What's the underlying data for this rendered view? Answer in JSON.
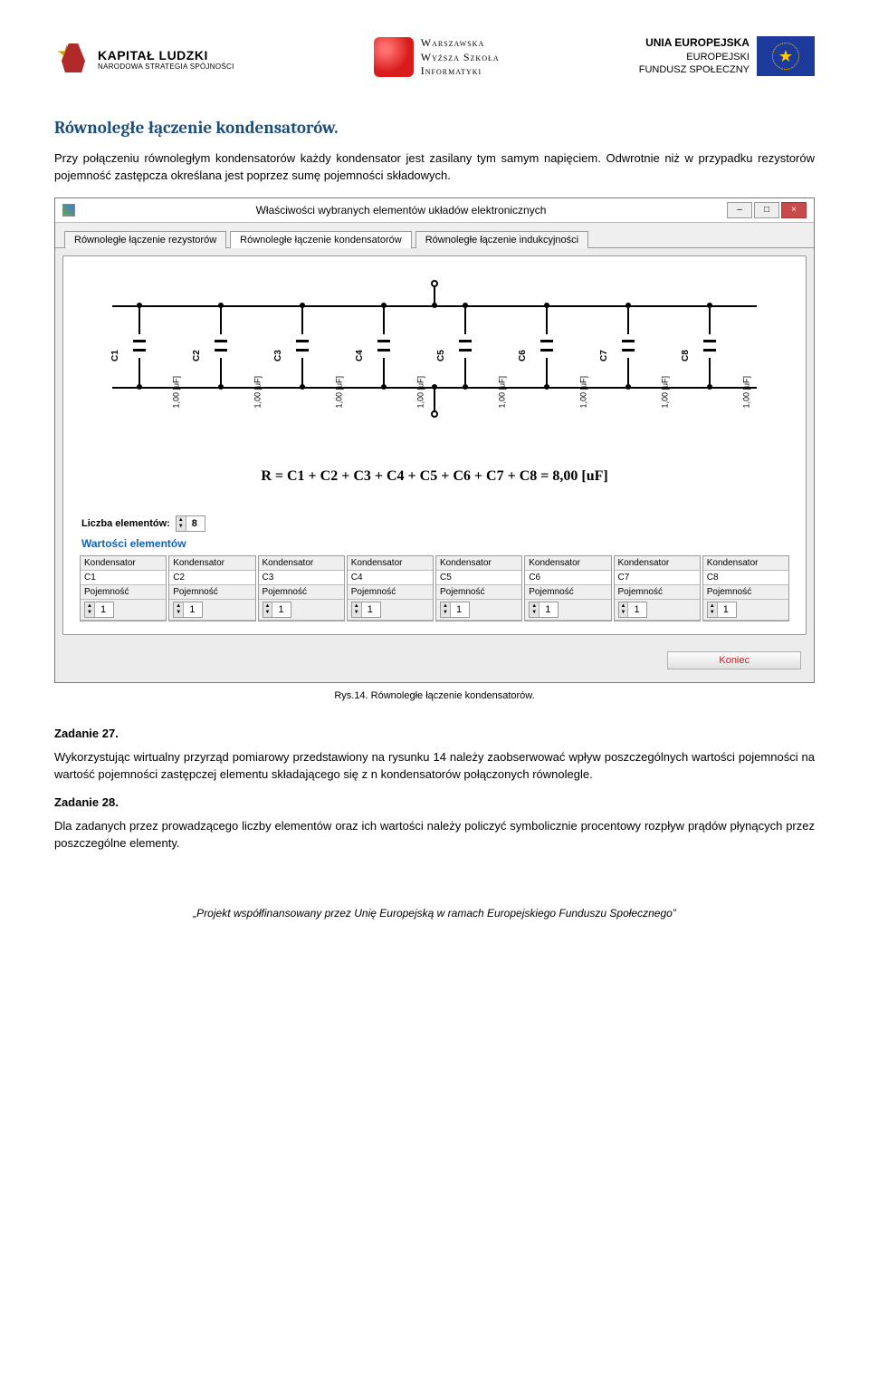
{
  "logos": {
    "kl": {
      "title": "KAPITAŁ LUDZKI",
      "subtitle": "NARODOWA STRATEGIA SPÓJNOŚCI"
    },
    "wsi": {
      "l1": "Warszawska",
      "l2": "Wyższa Szkoła",
      "l3": "Informatyki"
    },
    "eu": {
      "l1": "UNIA EUROPEJSKA",
      "l2": "EUROPEJSKI",
      "l3": "FUNDUSZ SPOŁECZNY"
    }
  },
  "section_title": "Równoległe łączenie kondensatorów.",
  "intro": "Przy połączeniu równoległym kondensatorów każdy kondensator jest zasilany tym samym napięciem. Odwrotnie niż w przypadku rezystorów pojemność zastępcza określana jest poprzez sumę pojemności składowych.",
  "window": {
    "title": "Właściwości wybranych elementów układów elektronicznych",
    "min": "–",
    "max": "□",
    "close": "×",
    "tabs": [
      "Równoległe łączenie rezystorów",
      "Równoległe łączenie kondensatorów",
      "Równoległe łączenie indukcyjności"
    ],
    "caps": [
      {
        "name": "C1",
        "val": "1,00 [uF]"
      },
      {
        "name": "C2",
        "val": "1,00 [uF]"
      },
      {
        "name": "C3",
        "val": "1,00 [uF]"
      },
      {
        "name": "C4",
        "val": "1,00 [uF]"
      },
      {
        "name": "C5",
        "val": "1,00 [uF]"
      },
      {
        "name": "C6",
        "val": "1,00 [uF]"
      },
      {
        "name": "C7",
        "val": "1,00 [uF]"
      },
      {
        "name": "C8",
        "val": "1,00 [uF]"
      }
    ],
    "formula": "R = C1 + C2 + C3 + C4 + C5 + C6 + C7 + C8 = 8,00 [uF]",
    "count_label": "Liczba elementów:",
    "count_value": "8",
    "values_label": "Wartości elementów",
    "grid_header": "Kondensator",
    "grid_row2": "Pojemność",
    "grid_names": [
      "C1",
      "C2",
      "C3",
      "C4",
      "C5",
      "C6",
      "C7",
      "C8"
    ],
    "grid_vals": [
      "1",
      "1",
      "1",
      "1",
      "1",
      "1",
      "1",
      "1"
    ],
    "end_btn": "Koniec"
  },
  "caption": "Rys.14. Równoległe łączenie kondensatorów.",
  "task27_label": "Zadanie 27.",
  "task27_body": "Wykorzystując wirtualny przyrząd pomiarowy przedstawiony na rysunku 14 należy zaobserwować wpływ poszczególnych wartości pojemności na wartość pojemności zastępczej elementu składającego się z n kondensatorów połączonych równolegle.",
  "task28_label": "Zadanie 28.",
  "task28_body": "Dla zadanych przez prowadzącego liczby elementów oraz ich wartości należy policzyć symbolicznie procentowy rozpływ prądów płynących przez poszczególne elementy.",
  "footer_prefix": "„Projekt współfinansowany przez Unię Europejską w ramach Europejskiego Funduszu ",
  "footer_suffix_italic": "Społecznego”"
}
